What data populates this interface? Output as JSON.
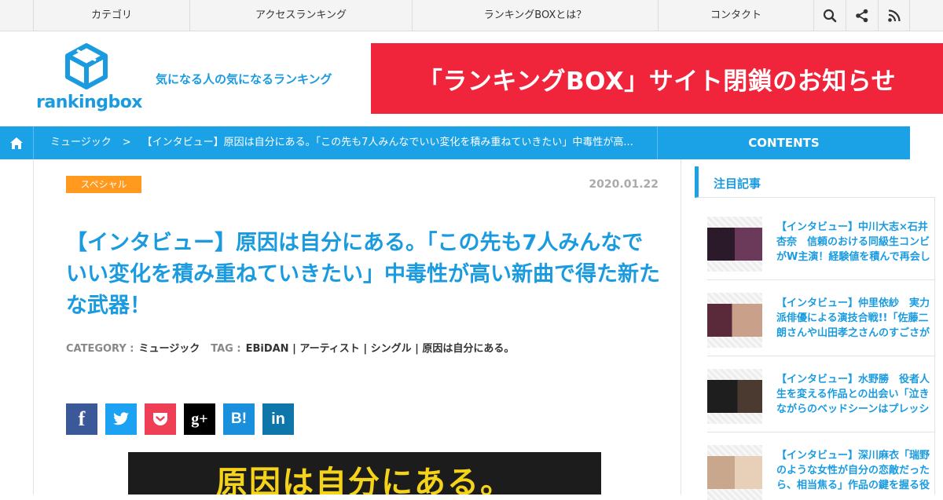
{
  "topnav": {
    "items": [
      "カテゴリ",
      "アクセスランキング",
      "ランキングBOXとは？",
      "コンタクト"
    ],
    "icons": [
      "search-icon",
      "share-icon",
      "rss-icon"
    ]
  },
  "header": {
    "logo_text": "rankingbox",
    "tagline": "気になる人の気になるランキング",
    "banner": "「ランキングBOX」サイト閉鎖のお知らせ"
  },
  "breadcrumb": {
    "category": "ミュージック",
    "separator": ">",
    "current": "【インタビュー】原因は自分にある。「この先も7人みんなでいい変化を積み重ねていきたい」中毒性が高..."
  },
  "contents_label": "CONTENTS",
  "article": {
    "badge": "スペシャル",
    "date": "2020.01.22",
    "title": "【インタビュー】原因は自分にある。「この先も7人みんなでいい変化を積み重ねていきたい」中毒性が高い新曲で得た新たな武器！",
    "meta": {
      "category_label": "CATEGORY :",
      "category": "ミュージック",
      "tag_label": "TAG :",
      "tags": "EBiDAN | アーティスト | シングル | 原因は自分にある。"
    },
    "share": [
      {
        "name": "facebook",
        "glyph": "f",
        "color": "#3b5998"
      },
      {
        "name": "twitter",
        "glyph": "t",
        "color": "#1da1f2"
      },
      {
        "name": "pocket",
        "glyph": "p",
        "color": "#ef3f56"
      },
      {
        "name": "google-plus",
        "glyph": "g+",
        "color": "#000000"
      },
      {
        "name": "hatena",
        "glyph": "B!",
        "color": "#1a8fdc"
      },
      {
        "name": "linkedin",
        "glyph": "in",
        "color": "#0e76a8"
      }
    ],
    "hero_text": "原因は自分にある。"
  },
  "sidebar": {
    "heading": "注目記事",
    "items": [
      {
        "title": "【インタビュー】中川大志×石井杏奈　信頼のおける同級生コンビがW主演！経験値を積んで再会し"
      },
      {
        "title": "【インタビュー】仲里依紗　実力派俳優による演技合戦!!「佐藤二朗さんや山田孝之さんのすごさが"
      },
      {
        "title": "【インタビュー】水野勝　役者人生を変える作品との出会い「泣きながらのベッドシーンはプレッシ"
      },
      {
        "title": "【インタビュー】深川麻衣「瑞野のような女性が自分の恋敵だったら、相当焦る」作品の鍵を握る役"
      }
    ]
  }
}
